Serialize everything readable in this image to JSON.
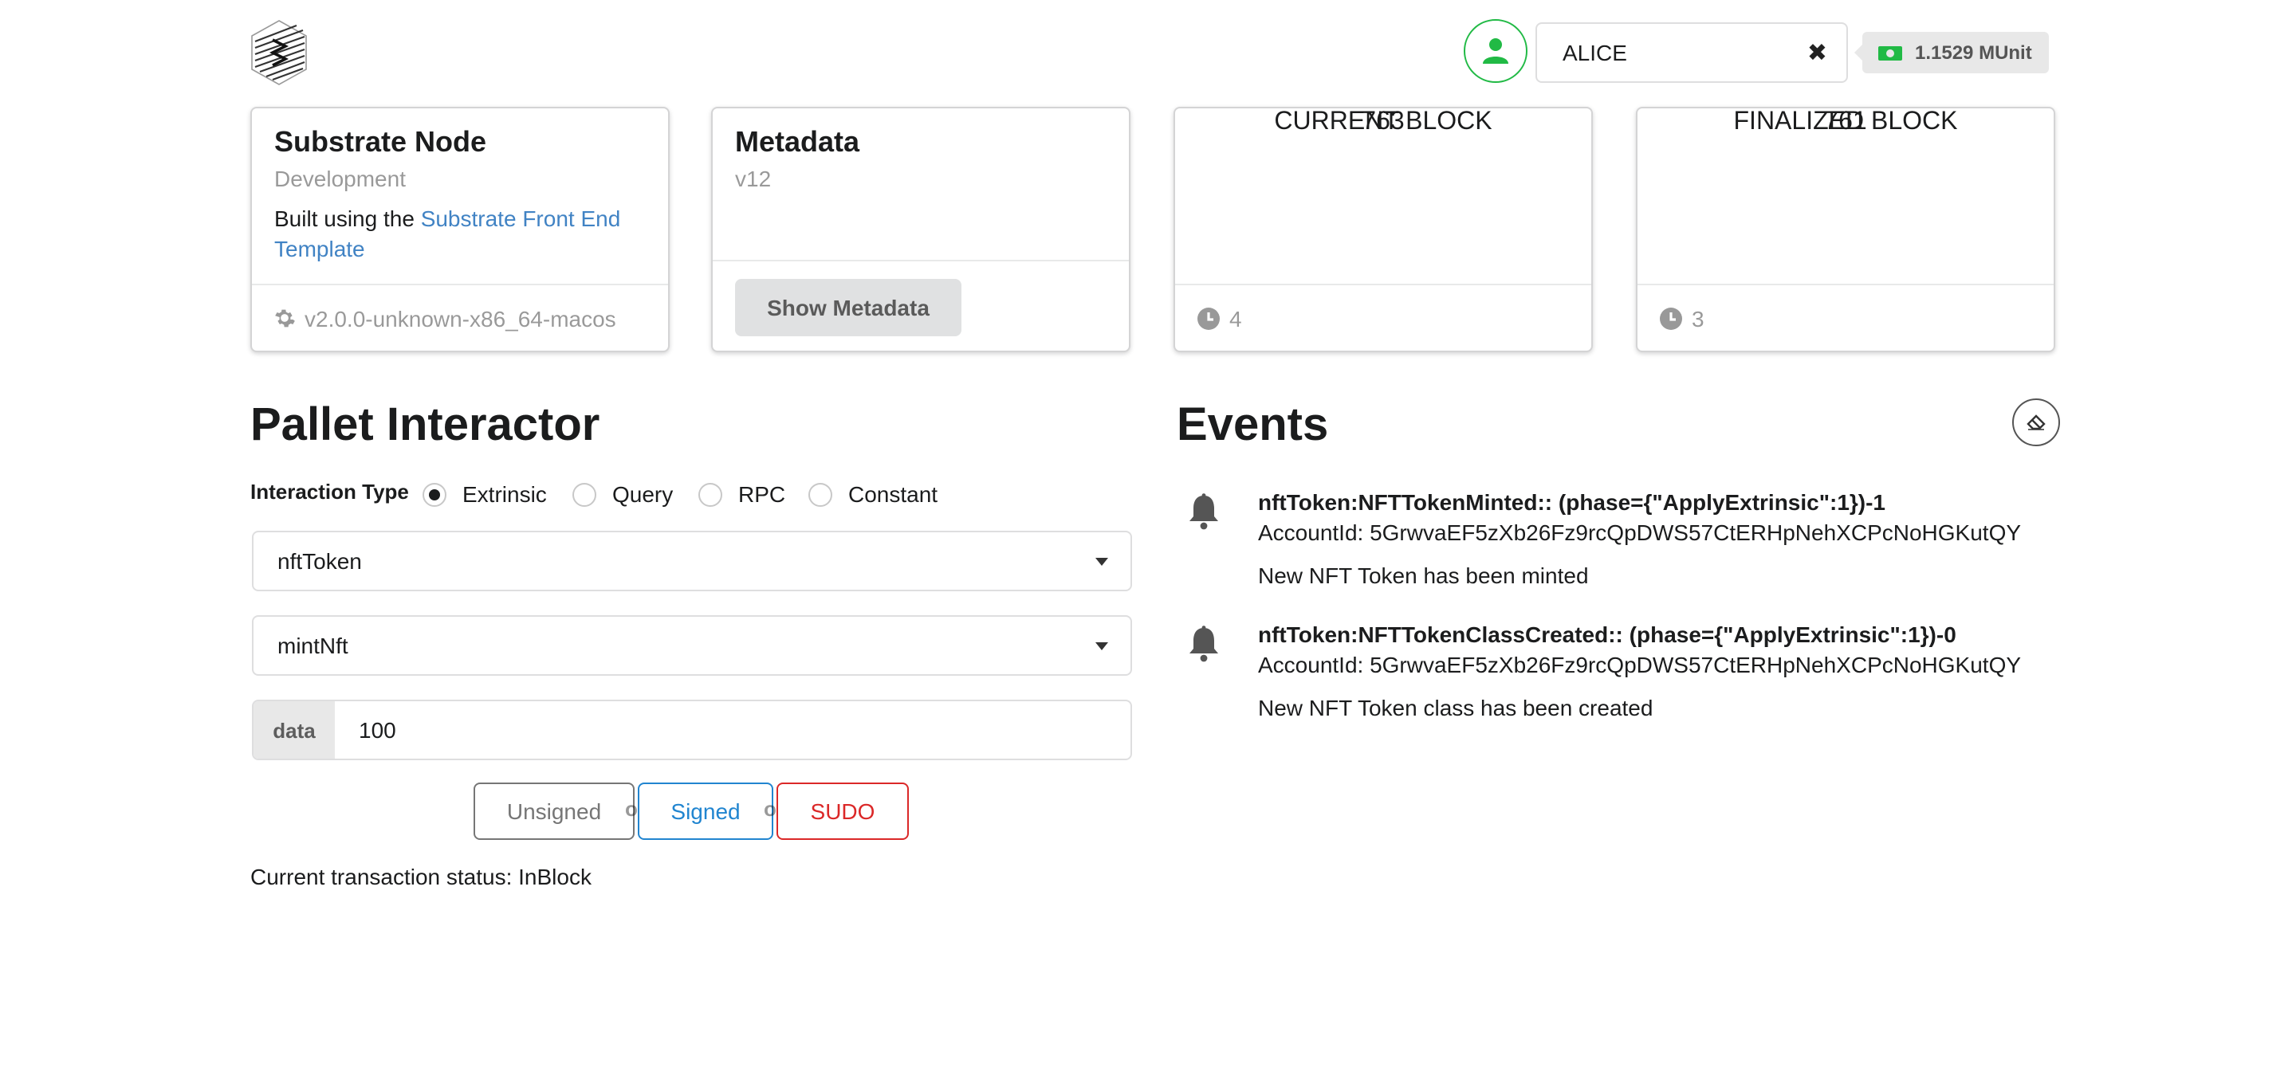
{
  "topbar": {
    "logo_icon": "substrate-logo-icon",
    "avatar_icon": "user-icon",
    "account_name": "ALICE",
    "clear_icon": "close-icon",
    "balance": "1.1529 MUnit",
    "balance_icon": "money-icon",
    "accent_color": "#21ba45"
  },
  "cards": {
    "node": {
      "title": "Substrate Node",
      "meta": "Development",
      "desc_prefix": "Built using the ",
      "desc_link": "Substrate Front End Template",
      "version": "v2.0.0-unknown-x86_64-macos",
      "version_icon": "gear-icon"
    },
    "metadata": {
      "title": "Metadata",
      "meta": "v12",
      "button": "Show Metadata"
    },
    "current_block": {
      "value": "763",
      "label": "CURRENT BLOCK",
      "timer": "4",
      "timer_icon": "clock-icon"
    },
    "finalized_block": {
      "value": "761",
      "label": "FINALIZED BLOCK",
      "timer": "3",
      "timer_icon": "clock-icon"
    }
  },
  "pallet": {
    "title": "Pallet Interactor",
    "interaction_type_label": "Interaction Type",
    "types": [
      "Extrinsic",
      "Query",
      "RPC",
      "Constant"
    ],
    "selected_type": "Extrinsic",
    "pallet_value": "nftToken",
    "callable_value": "mintNft",
    "param_label": "data",
    "param_value": "100",
    "buttons": {
      "unsigned": "Unsigned",
      "signed": "Signed",
      "sudo": "SUDO",
      "or": "or"
    },
    "colors": {
      "signed": "#2185d0",
      "sudo": "#db2828",
      "unsigned": "#767676"
    },
    "status": "Current transaction status: InBlock"
  },
  "events": {
    "title": "Events",
    "erase_icon": "eraser-icon",
    "items": [
      {
        "icon": "bell-icon",
        "header": "nftToken:NFTTokenMinted:: (phase={\"ApplyExtrinsic\":1})-1",
        "data": "AccountId: 5GrwvaEF5zXb26Fz9rcQpDWS57CtERHpNehXCPcNoHGKutQY",
        "doc": "New NFT Token has been minted"
      },
      {
        "icon": "bell-icon",
        "header": "nftToken:NFTTokenClassCreated:: (phase={\"ApplyExtrinsic\":1})-0",
        "data": "AccountId: 5GrwvaEF5zXb26Fz9rcQpDWS57CtERHpNehXCPcNoHGKutQY",
        "doc": "New NFT Token class has been created"
      }
    ]
  }
}
